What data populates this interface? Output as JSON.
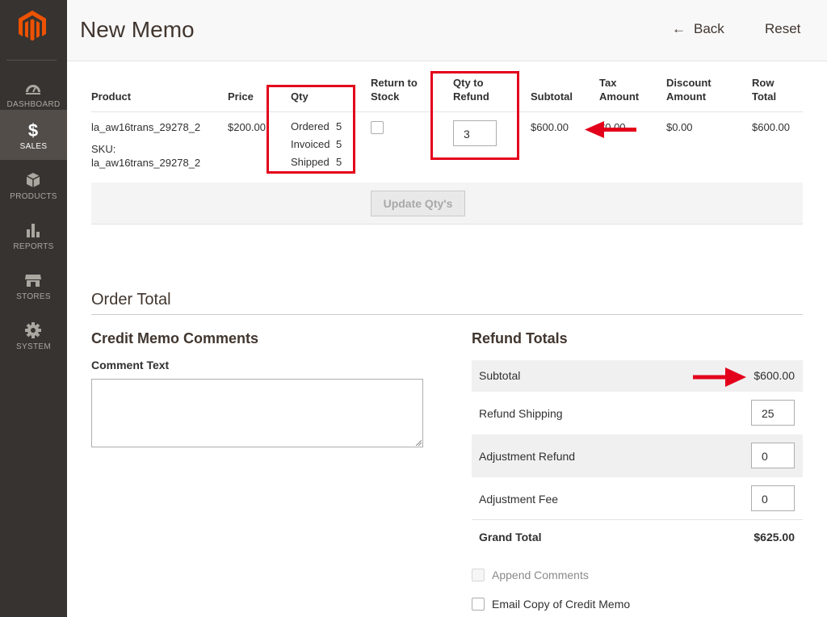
{
  "sidebar": {
    "items": [
      {
        "label": "DASHBOARD",
        "icon": "dashboard-icon",
        "active": false
      },
      {
        "label": "SALES",
        "icon": "dollar-icon",
        "active": true
      },
      {
        "label": "PRODUCTS",
        "icon": "box-icon",
        "active": false
      },
      {
        "label": "REPORTS",
        "icon": "bar-chart-icon",
        "active": false
      },
      {
        "label": "STORES",
        "icon": "store-icon",
        "active": false
      },
      {
        "label": "SYSTEM",
        "icon": "gear-icon",
        "active": false
      }
    ]
  },
  "header": {
    "title": "New Memo",
    "back_label": "Back",
    "reset_label": "Reset"
  },
  "items_table": {
    "headers": {
      "product": "Product",
      "price": "Price",
      "qty": "Qty",
      "return_to_stock": [
        "Return to",
        "Stock"
      ],
      "qty_to_refund": [
        "Qty to",
        "Refund"
      ],
      "subtotal": "Subtotal",
      "tax_amount": [
        "Tax",
        "Amount"
      ],
      "discount_amount": [
        "Discount",
        "Amount"
      ],
      "row_total": [
        "Row",
        "Total"
      ]
    },
    "row": {
      "product_name": "la_aw16trans_29278_2",
      "sku_label": "SKU:",
      "sku": "la_aw16trans_29278_2",
      "price": "$200.00",
      "qty": [
        {
          "label": "Ordered",
          "value": "5"
        },
        {
          "label": "Invoiced",
          "value": "5"
        },
        {
          "label": "Shipped",
          "value": "5"
        }
      ],
      "qty_to_refund": "3",
      "subtotal": "$600.00",
      "tax_amount": "$0.00",
      "discount_amount": "$0.00",
      "row_total": "$600.00"
    },
    "update_button": "Update Qty's"
  },
  "order_total": {
    "title": "Order Total",
    "comments": {
      "title": "Credit Memo Comments",
      "comment_label": "Comment Text",
      "comment_value": ""
    },
    "refund_totals": {
      "title": "Refund Totals",
      "subtotal_label": "Subtotal",
      "subtotal_value": "$600.00",
      "refund_shipping_label": "Refund Shipping",
      "refund_shipping_value": "25",
      "adjustment_refund_label": "Adjustment Refund",
      "adjustment_refund_value": "0",
      "adjustment_fee_label": "Adjustment Fee",
      "adjustment_fee_value": "0",
      "grand_total_label": "Grand Total",
      "grand_total_value": "$625.00",
      "append_comments_label": "Append Comments",
      "email_copy_label": "Email Copy of Credit Memo"
    }
  },
  "colors": {
    "sidebar_bg": "#373330",
    "logo": "#eb5202",
    "annotation_red": "#e3001b"
  }
}
